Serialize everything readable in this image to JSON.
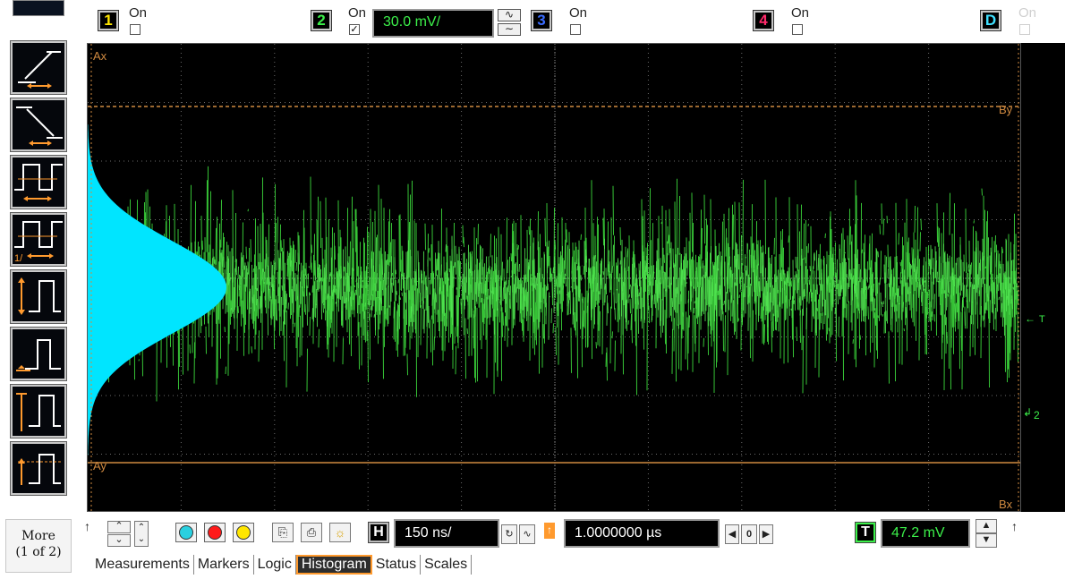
{
  "channels": [
    {
      "label": "1",
      "on_label": "On",
      "checked": false,
      "color": "#ffe600"
    },
    {
      "label": "2",
      "on_label": "On",
      "checked": true,
      "color": "#3cf04a"
    },
    {
      "label": "3",
      "on_label": "On",
      "checked": false,
      "color": "#3a6cff"
    },
    {
      "label": "4",
      "on_label": "On",
      "checked": false,
      "color": "#ff2a6a"
    },
    {
      "label": "D",
      "on_label": "On",
      "checked": false,
      "color": "#40e0ff"
    }
  ],
  "ch2_scale": "30.0 mV/",
  "screen": {
    "marker_ax": "Ax",
    "marker_bx": "Bx",
    "marker_ay": "Ay",
    "marker_by": "By",
    "trigger_marker": "T",
    "ground_marker": "2",
    "waveform_color": "#3cd83c",
    "histogram_color": "#00e5ff",
    "marker_color": "#d08a40"
  },
  "left_toolbar": {
    "tools": [
      "rise-time-icon",
      "fall-time-icon",
      "period-icon",
      "frequency-icon",
      "peak-to-peak-icon",
      "minimum-icon",
      "maximum-icon",
      "amplitude-icon"
    ],
    "more_line1": "More",
    "more_line2": "(1 of 2)"
  },
  "horizontal": {
    "h_label": "H",
    "scale": "150 ns/",
    "delay_value": "1.0000000 µs",
    "delay_zero": "0"
  },
  "trigger": {
    "t_label": "T",
    "level": "47.2 mV"
  },
  "tabs": [
    "Measurements",
    "Markers",
    "Logic",
    "Histogram",
    "Status",
    "Scales"
  ],
  "active_tab": "Histogram"
}
